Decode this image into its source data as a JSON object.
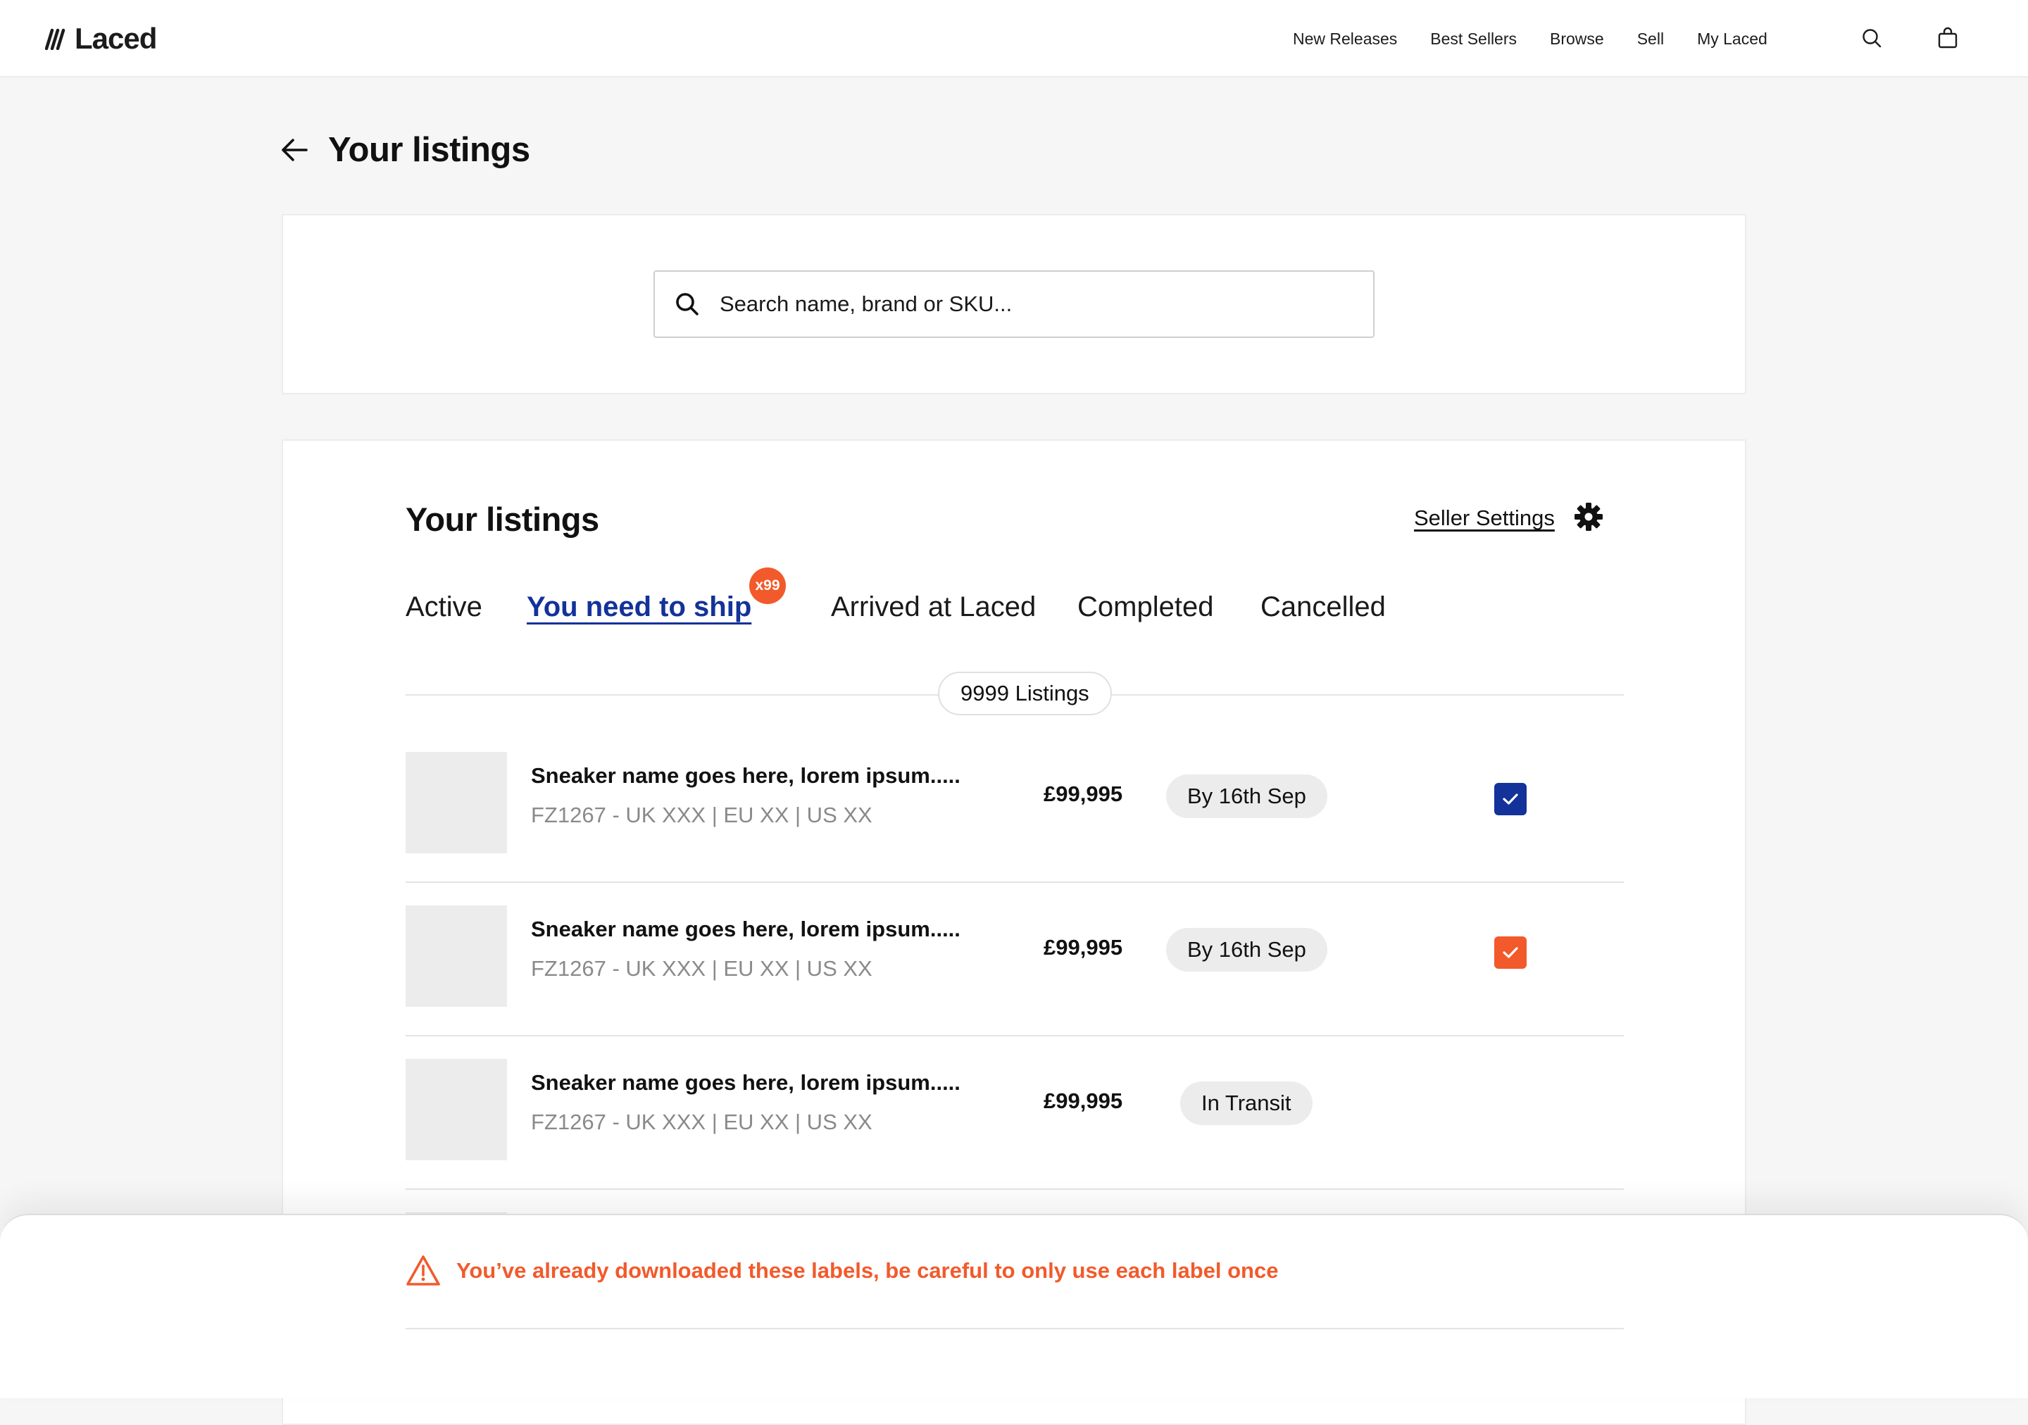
{
  "nav": {
    "logo_text": "Laced",
    "links": [
      "New Releases",
      "Best Sellers",
      "Browse",
      "Sell",
      "My Laced"
    ],
    "icons": [
      "search-icon",
      "bag-icon"
    ]
  },
  "page": {
    "title": "Your listings",
    "back_icon": "arrow-left-icon"
  },
  "search": {
    "placeholder": "Search name, brand or SKU...",
    "value": "",
    "icon": "search-icon"
  },
  "listings": {
    "title": "Your listings",
    "seller_settings_label": "Seller Settings",
    "settings_icon": "gear-icon",
    "tabs": [
      {
        "label": "Active"
      },
      {
        "label": "You need to ship",
        "badge": "x99"
      },
      {
        "label": "Arrived at Laced"
      },
      {
        "label": "Completed"
      },
      {
        "label": "Cancelled"
      }
    ],
    "active_tab": "You need to ship",
    "count_label": "9999 Listings",
    "items": [
      {
        "name": "Sneaker name goes here, lorem ipsum.....",
        "sku": "FZ1267 - UK XXX | EU XX | US XX",
        "price": "£99,995",
        "status": "By 16th Sep",
        "checked": true,
        "check_color": "#13329a"
      },
      {
        "name": "Sneaker name goes here, lorem ipsum.....",
        "sku": "FZ1267 - UK XXX | EU XX | US XX",
        "price": "£99,995",
        "status": "By 16th Sep",
        "checked": true,
        "check_color": "#f25a2b"
      },
      {
        "name": "Sneaker name goes here, lorem ipsum.....",
        "sku": "FZ1267 - UK XXX | EU XX | US XX",
        "price": "£99,995",
        "status": "In Transit",
        "checked": false
      }
    ]
  },
  "warning": {
    "icon": "warning-triangle-icon",
    "text": "You’ve already downloaded these labels, be careful to only use each label once"
  },
  "colors": {
    "brand_blue": "#13329a",
    "accent_orange": "#f25a2b",
    "background": "#f6f6f6",
    "placeholder_grey": "#ececec"
  }
}
